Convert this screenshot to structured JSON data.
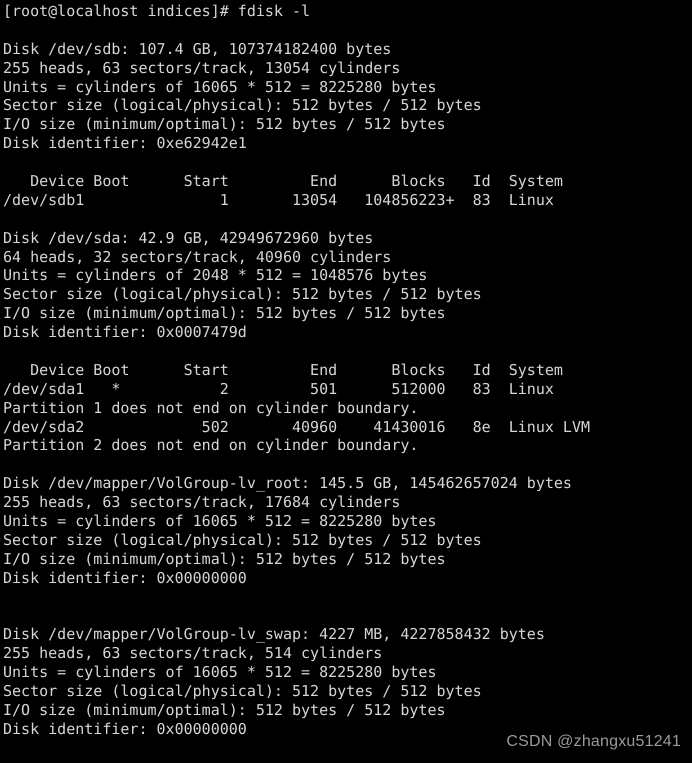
{
  "terminal": {
    "background_color": "#000000",
    "foreground_color": "#d6d6d6",
    "prompt": "[root@localhost indices]#",
    "command": "fdisk -l",
    "prompt_line": "[root@localhost indices]# fdisk -l",
    "lines": [
      "[root@localhost indices]# fdisk -l",
      "",
      "Disk /dev/sdb: 107.4 GB, 107374182400 bytes",
      "255 heads, 63 sectors/track, 13054 cylinders",
      "Units = cylinders of 16065 * 512 = 8225280 bytes",
      "Sector size (logical/physical): 512 bytes / 512 bytes",
      "I/O size (minimum/optimal): 512 bytes / 512 bytes",
      "Disk identifier: 0xe62942e1",
      "",
      "   Device Boot      Start         End      Blocks   Id  System",
      "/dev/sdb1               1       13054   104856223+  83  Linux",
      "",
      "Disk /dev/sda: 42.9 GB, 42949672960 bytes",
      "64 heads, 32 sectors/track, 40960 cylinders",
      "Units = cylinders of 2048 * 512 = 1048576 bytes",
      "Sector size (logical/physical): 512 bytes / 512 bytes",
      "I/O size (minimum/optimal): 512 bytes / 512 bytes",
      "Disk identifier: 0x0007479d",
      "",
      "   Device Boot      Start         End      Blocks   Id  System",
      "/dev/sda1   *           2         501      512000   83  Linux",
      "Partition 1 does not end on cylinder boundary.",
      "/dev/sda2             502       40960    41430016   8e  Linux LVM",
      "Partition 2 does not end on cylinder boundary.",
      "",
      "Disk /dev/mapper/VolGroup-lv_root: 145.5 GB, 145462657024 bytes",
      "255 heads, 63 sectors/track, 17684 cylinders",
      "Units = cylinders of 16065 * 512 = 8225280 bytes",
      "Sector size (logical/physical): 512 bytes / 512 bytes",
      "I/O size (minimum/optimal): 512 bytes / 512 bytes",
      "Disk identifier: 0x00000000",
      "",
      "",
      "Disk /dev/mapper/VolGroup-lv_swap: 4227 MB, 4227858432 bytes",
      "255 heads, 63 sectors/track, 514 cylinders",
      "Units = cylinders of 16065 * 512 = 8225280 bytes",
      "Sector size (logical/physical): 512 bytes / 512 bytes",
      "I/O size (minimum/optimal): 512 bytes / 512 bytes",
      "Disk identifier: 0x00000000"
    ]
  },
  "disks": [
    {
      "device": "/dev/sdb",
      "size_human": "107.4 GB",
      "size_bytes": "107374182400 bytes",
      "heads": "255",
      "sectors_per_track": "63",
      "cylinders": "13054",
      "units": "cylinders of 16065 * 512 = 8225280 bytes",
      "sector_size": "512 bytes / 512 bytes",
      "io_size": "512 bytes / 512 bytes",
      "identifier": "0xe62942e1",
      "table": {
        "headers": [
          "Device",
          "Boot",
          "Start",
          "End",
          "Blocks",
          "Id",
          "System"
        ],
        "rows": [
          {
            "device": "/dev/sdb1",
            "boot": "",
            "start": "1",
            "end": "13054",
            "blocks": "104856223+",
            "id": "83",
            "system": "Linux"
          }
        ],
        "notes": []
      }
    },
    {
      "device": "/dev/sda",
      "size_human": "42.9 GB",
      "size_bytes": "42949672960 bytes",
      "heads": "64",
      "sectors_per_track": "32",
      "cylinders": "40960",
      "units": "cylinders of 2048 * 512 = 1048576 bytes",
      "sector_size": "512 bytes / 512 bytes",
      "io_size": "512 bytes / 512 bytes",
      "identifier": "0x0007479d",
      "table": {
        "headers": [
          "Device",
          "Boot",
          "Start",
          "End",
          "Blocks",
          "Id",
          "System"
        ],
        "rows": [
          {
            "device": "/dev/sda1",
            "boot": "*",
            "start": "2",
            "end": "501",
            "blocks": "512000",
            "id": "83",
            "system": "Linux"
          },
          {
            "device": "/dev/sda2",
            "boot": "",
            "start": "502",
            "end": "40960",
            "blocks": "41430016",
            "id": "8e",
            "system": "Linux LVM"
          }
        ],
        "notes": [
          "Partition 1 does not end on cylinder boundary.",
          "Partition 2 does not end on cylinder boundary."
        ]
      }
    },
    {
      "device": "/dev/mapper/VolGroup-lv_root",
      "size_human": "145.5 GB",
      "size_bytes": "145462657024 bytes",
      "heads": "255",
      "sectors_per_track": "63",
      "cylinders": "17684",
      "units": "cylinders of 16065 * 512 = 8225280 bytes",
      "sector_size": "512 bytes / 512 bytes",
      "io_size": "512 bytes / 512 bytes",
      "identifier": "0x00000000",
      "table": null
    },
    {
      "device": "/dev/mapper/VolGroup-lv_swap",
      "size_human": "4227 MB",
      "size_bytes": "4227858432 bytes",
      "heads": "255",
      "sectors_per_track": "63",
      "cylinders": "514",
      "units": "cylinders of 16065 * 512 = 8225280 bytes",
      "sector_size": "512 bytes / 512 bytes",
      "io_size": "512 bytes / 512 bytes",
      "identifier": "0x00000000",
      "table": null
    }
  ],
  "watermark": {
    "text": "CSDN @zhangxu51241",
    "color": "#9a9a9a"
  }
}
